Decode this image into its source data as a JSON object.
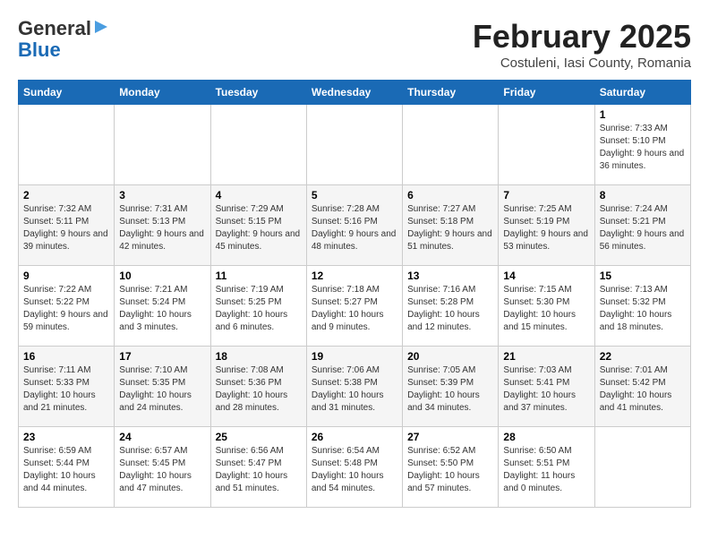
{
  "header": {
    "logo_general": "General",
    "logo_blue": "Blue",
    "month_title": "February 2025",
    "subtitle": "Costuleni, Iasi County, Romania"
  },
  "days_of_week": [
    "Sunday",
    "Monday",
    "Tuesday",
    "Wednesday",
    "Thursday",
    "Friday",
    "Saturday"
  ],
  "weeks": [
    [
      {
        "day": "",
        "info": ""
      },
      {
        "day": "",
        "info": ""
      },
      {
        "day": "",
        "info": ""
      },
      {
        "day": "",
        "info": ""
      },
      {
        "day": "",
        "info": ""
      },
      {
        "day": "",
        "info": ""
      },
      {
        "day": "1",
        "info": "Sunrise: 7:33 AM\nSunset: 5:10 PM\nDaylight: 9 hours and 36 minutes."
      }
    ],
    [
      {
        "day": "2",
        "info": "Sunrise: 7:32 AM\nSunset: 5:11 PM\nDaylight: 9 hours and 39 minutes."
      },
      {
        "day": "3",
        "info": "Sunrise: 7:31 AM\nSunset: 5:13 PM\nDaylight: 9 hours and 42 minutes."
      },
      {
        "day": "4",
        "info": "Sunrise: 7:29 AM\nSunset: 5:15 PM\nDaylight: 9 hours and 45 minutes."
      },
      {
        "day": "5",
        "info": "Sunrise: 7:28 AM\nSunset: 5:16 PM\nDaylight: 9 hours and 48 minutes."
      },
      {
        "day": "6",
        "info": "Sunrise: 7:27 AM\nSunset: 5:18 PM\nDaylight: 9 hours and 51 minutes."
      },
      {
        "day": "7",
        "info": "Sunrise: 7:25 AM\nSunset: 5:19 PM\nDaylight: 9 hours and 53 minutes."
      },
      {
        "day": "8",
        "info": "Sunrise: 7:24 AM\nSunset: 5:21 PM\nDaylight: 9 hours and 56 minutes."
      }
    ],
    [
      {
        "day": "9",
        "info": "Sunrise: 7:22 AM\nSunset: 5:22 PM\nDaylight: 9 hours and 59 minutes."
      },
      {
        "day": "10",
        "info": "Sunrise: 7:21 AM\nSunset: 5:24 PM\nDaylight: 10 hours and 3 minutes."
      },
      {
        "day": "11",
        "info": "Sunrise: 7:19 AM\nSunset: 5:25 PM\nDaylight: 10 hours and 6 minutes."
      },
      {
        "day": "12",
        "info": "Sunrise: 7:18 AM\nSunset: 5:27 PM\nDaylight: 10 hours and 9 minutes."
      },
      {
        "day": "13",
        "info": "Sunrise: 7:16 AM\nSunset: 5:28 PM\nDaylight: 10 hours and 12 minutes."
      },
      {
        "day": "14",
        "info": "Sunrise: 7:15 AM\nSunset: 5:30 PM\nDaylight: 10 hours and 15 minutes."
      },
      {
        "day": "15",
        "info": "Sunrise: 7:13 AM\nSunset: 5:32 PM\nDaylight: 10 hours and 18 minutes."
      }
    ],
    [
      {
        "day": "16",
        "info": "Sunrise: 7:11 AM\nSunset: 5:33 PM\nDaylight: 10 hours and 21 minutes."
      },
      {
        "day": "17",
        "info": "Sunrise: 7:10 AM\nSunset: 5:35 PM\nDaylight: 10 hours and 24 minutes."
      },
      {
        "day": "18",
        "info": "Sunrise: 7:08 AM\nSunset: 5:36 PM\nDaylight: 10 hours and 28 minutes."
      },
      {
        "day": "19",
        "info": "Sunrise: 7:06 AM\nSunset: 5:38 PM\nDaylight: 10 hours and 31 minutes."
      },
      {
        "day": "20",
        "info": "Sunrise: 7:05 AM\nSunset: 5:39 PM\nDaylight: 10 hours and 34 minutes."
      },
      {
        "day": "21",
        "info": "Sunrise: 7:03 AM\nSunset: 5:41 PM\nDaylight: 10 hours and 37 minutes."
      },
      {
        "day": "22",
        "info": "Sunrise: 7:01 AM\nSunset: 5:42 PM\nDaylight: 10 hours and 41 minutes."
      }
    ],
    [
      {
        "day": "23",
        "info": "Sunrise: 6:59 AM\nSunset: 5:44 PM\nDaylight: 10 hours and 44 minutes."
      },
      {
        "day": "24",
        "info": "Sunrise: 6:57 AM\nSunset: 5:45 PM\nDaylight: 10 hours and 47 minutes."
      },
      {
        "day": "25",
        "info": "Sunrise: 6:56 AM\nSunset: 5:47 PM\nDaylight: 10 hours and 51 minutes."
      },
      {
        "day": "26",
        "info": "Sunrise: 6:54 AM\nSunset: 5:48 PM\nDaylight: 10 hours and 54 minutes."
      },
      {
        "day": "27",
        "info": "Sunrise: 6:52 AM\nSunset: 5:50 PM\nDaylight: 10 hours and 57 minutes."
      },
      {
        "day": "28",
        "info": "Sunrise: 6:50 AM\nSunset: 5:51 PM\nDaylight: 11 hours and 0 minutes."
      },
      {
        "day": "",
        "info": ""
      }
    ]
  ]
}
